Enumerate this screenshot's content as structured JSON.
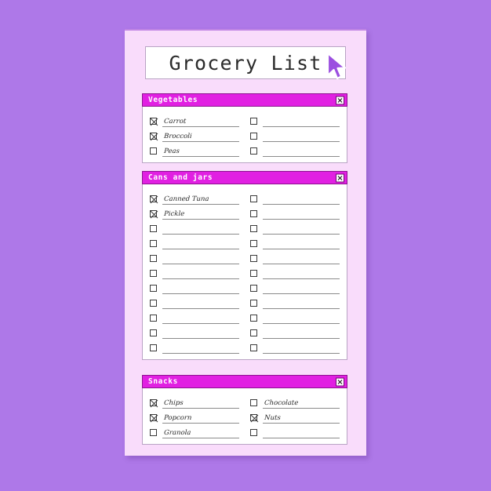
{
  "page": {
    "background_color": "#ae78e8",
    "paper_color": "#f9dcfb",
    "accent_color": "#e120e2"
  },
  "title": {
    "text": "Grocery List"
  },
  "close_icon_name": "close-icon",
  "sections": [
    {
      "name": "vegetables",
      "header": "Vegetables",
      "close_label": "×",
      "rows": 3,
      "left_items": [
        {
          "text": "Carrot",
          "checked": true
        },
        {
          "text": "Broccoli",
          "checked": true
        },
        {
          "text": "Peas",
          "checked": false
        }
      ],
      "right_items": [
        {
          "text": "",
          "checked": false
        },
        {
          "text": "",
          "checked": false
        },
        {
          "text": "",
          "checked": false
        }
      ]
    },
    {
      "name": "cans-and-jars",
      "header": "Cans and jars",
      "close_label": "×",
      "rows": 11,
      "left_items": [
        {
          "text": "Canned Tuna",
          "checked": true
        },
        {
          "text": "Pickle",
          "checked": true
        },
        {
          "text": "",
          "checked": false
        },
        {
          "text": "",
          "checked": false
        },
        {
          "text": "",
          "checked": false
        },
        {
          "text": "",
          "checked": false
        },
        {
          "text": "",
          "checked": false
        },
        {
          "text": "",
          "checked": false
        },
        {
          "text": "",
          "checked": false
        },
        {
          "text": "",
          "checked": false
        },
        {
          "text": "",
          "checked": false
        }
      ],
      "right_items": [
        {
          "text": "",
          "checked": false
        },
        {
          "text": "",
          "checked": false
        },
        {
          "text": "",
          "checked": false
        },
        {
          "text": "",
          "checked": false
        },
        {
          "text": "",
          "checked": false
        },
        {
          "text": "",
          "checked": false
        },
        {
          "text": "",
          "checked": false
        },
        {
          "text": "",
          "checked": false
        },
        {
          "text": "",
          "checked": false
        },
        {
          "text": "",
          "checked": false
        },
        {
          "text": "",
          "checked": false
        }
      ]
    },
    {
      "name": "snacks",
      "header": "Snacks",
      "close_label": "×",
      "rows": 3,
      "left_items": [
        {
          "text": "Chips",
          "checked": true
        },
        {
          "text": "Popcorn",
          "checked": true
        },
        {
          "text": "Granola",
          "checked": false
        }
      ],
      "right_items": [
        {
          "text": "Chocolate",
          "checked": false
        },
        {
          "text": "Nuts",
          "checked": true
        },
        {
          "text": "",
          "checked": false
        }
      ]
    }
  ],
  "cursor": {
    "name": "mouse-pointer",
    "color": "#9b4fe0"
  }
}
